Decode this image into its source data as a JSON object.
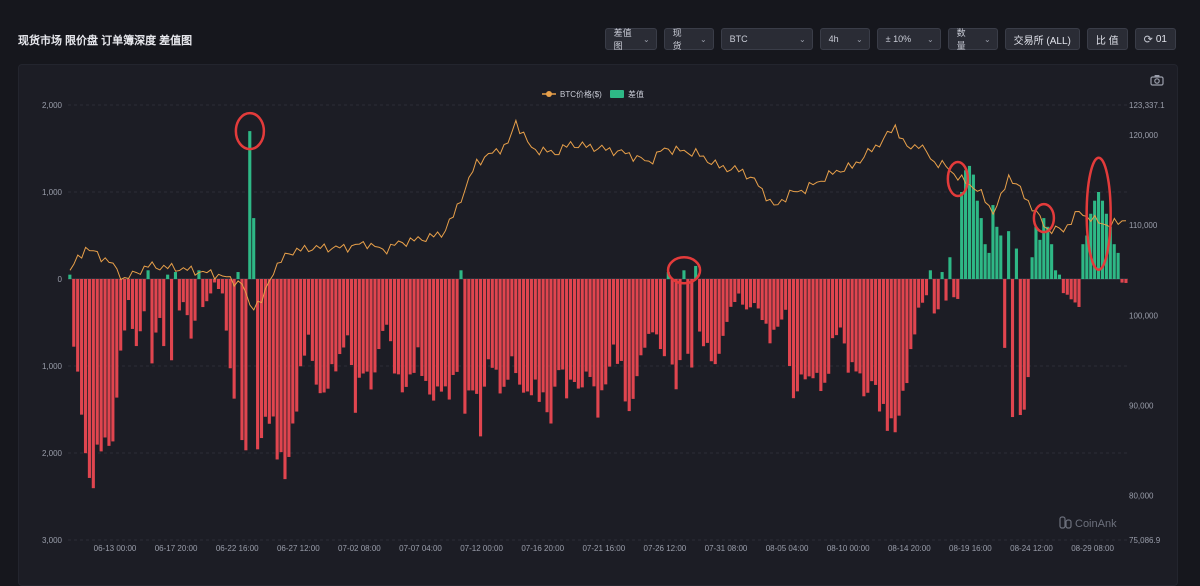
{
  "header": {
    "title": "现货市场 限价盘 订单簿深度 差值图"
  },
  "toolbar": {
    "chart_type": "差值图",
    "market": "现货",
    "coin": "BTC",
    "interval": "4h",
    "range": "± 10%",
    "metric": "数量",
    "exchange_button": "交易所 (ALL)",
    "ratio_button": "比 值",
    "refresh_label": "01"
  },
  "watermark": "CoinAnk",
  "colors": {
    "positive": "#2eb886",
    "negative": "#e0454f",
    "price_line": "#e8a04a",
    "highlight_circle": "#e33b3b",
    "background": "#1c1d25"
  },
  "chart_data": {
    "type": "bar",
    "legend": {
      "placement": "top-center",
      "entries": [
        "BTC价格($)",
        "差值"
      ]
    },
    "grid": true,
    "left_axis": {
      "ticks": [
        "2,000",
        "1,000",
        "0",
        "1,000",
        "2,000",
        "3,000"
      ],
      "range": [
        -3000,
        2000
      ]
    },
    "right_axis": {
      "ticks": [
        "123,337.1",
        "120,000",
        "110,000",
        "100,000",
        "90,000",
        "80,000",
        "75,086.9"
      ],
      "range": [
        75086.9,
        123337.1
      ]
    },
    "x_ticks": [
      "06-13 00:00",
      "06-17 20:00",
      "06-22 16:00",
      "06-27 12:00",
      "07-02 08:00",
      "07-07 04:00",
      "07-12 00:00",
      "07-16 20:00",
      "07-21 16:00",
      "07-26 12:00",
      "07-31 08:00",
      "08-05 04:00",
      "08-10 00:00",
      "08-14 20:00",
      "08-19 16:00",
      "08-24 12:00",
      "08-29 08:00"
    ],
    "series": [
      {
        "name": "差值",
        "anchors": [
          [
            0,
            -400
          ],
          [
            3,
            -1700
          ],
          [
            5,
            -2600
          ],
          [
            7,
            -2250
          ],
          [
            9,
            -2300
          ],
          [
            11,
            -2000
          ],
          [
            13,
            -1000
          ],
          [
            15,
            -300
          ],
          [
            17,
            -900
          ],
          [
            19,
            -400
          ],
          [
            21,
            -1000
          ],
          [
            23,
            -500
          ],
          [
            25,
            -1400
          ],
          [
            27,
            -600
          ],
          [
            29,
            -300
          ],
          [
            31,
            -700
          ],
          [
            33,
            -400
          ],
          [
            35,
            -300
          ],
          [
            37,
            -50
          ],
          [
            39,
            -200
          ],
          [
            41,
            -1100
          ],
          [
            43,
            -2000
          ],
          [
            45,
            -2300
          ],
          [
            47,
            -2200
          ],
          [
            49,
            -2000
          ],
          [
            51,
            -1800
          ],
          [
            53,
            -2200
          ],
          [
            55,
            -2500
          ],
          [
            57,
            -1900
          ],
          [
            59,
            -1200
          ],
          [
            61,
            -800
          ],
          [
            63,
            -1300
          ],
          [
            65,
            -1600
          ],
          [
            67,
            -1200
          ],
          [
            69,
            -1000
          ],
          [
            71,
            -700
          ],
          [
            73,
            -1600
          ],
          [
            75,
            -1200
          ],
          [
            77,
            -1400
          ],
          [
            79,
            -900
          ],
          [
            81,
            -600
          ],
          [
            83,
            -1100
          ],
          [
            85,
            -1400
          ],
          [
            87,
            -1300
          ],
          [
            89,
            -1000
          ],
          [
            91,
            -1400
          ],
          [
            93,
            -1500
          ],
          [
            95,
            -1300
          ],
          [
            97,
            -1600
          ],
          [
            99,
            -1200
          ],
          [
            101,
            -1700
          ],
          [
            103,
            -1400
          ],
          [
            105,
            -1900
          ],
          [
            107,
            -1000
          ],
          [
            109,
            -1200
          ],
          [
            111,
            -1500
          ],
          [
            113,
            -1100
          ],
          [
            115,
            -1300
          ],
          [
            117,
            -1600
          ],
          [
            119,
            -1400
          ],
          [
            121,
            -1500
          ],
          [
            123,
            -1800
          ],
          [
            125,
            -1100
          ],
          [
            127,
            -1500
          ],
          [
            129,
            -1300
          ],
          [
            131,
            -1400
          ],
          [
            133,
            -1300
          ],
          [
            135,
            -1600
          ],
          [
            137,
            -1300
          ],
          [
            139,
            -900
          ],
          [
            141,
            -1200
          ],
          [
            143,
            -1800
          ],
          [
            145,
            -1200
          ],
          [
            147,
            -800
          ],
          [
            149,
            -700
          ],
          [
            151,
            -900
          ],
          [
            153,
            -1000
          ],
          [
            155,
            -1400
          ],
          [
            157,
            -900
          ],
          [
            159,
            -1100
          ],
          [
            161,
            -700
          ],
          [
            163,
            -900
          ],
          [
            165,
            -1200
          ],
          [
            167,
            -700
          ],
          [
            169,
            -400
          ],
          [
            171,
            -200
          ],
          [
            173,
            -400
          ],
          [
            175,
            -300
          ],
          [
            177,
            -500
          ],
          [
            179,
            -800
          ],
          [
            181,
            -600
          ],
          [
            183,
            -400
          ],
          [
            185,
            -1600
          ],
          [
            187,
            -1400
          ],
          [
            189,
            -1200
          ],
          [
            191,
            -1300
          ],
          [
            193,
            -1500
          ],
          [
            195,
            -800
          ],
          [
            197,
            -600
          ],
          [
            199,
            -1100
          ],
          [
            201,
            -1200
          ],
          [
            203,
            -1500
          ],
          [
            205,
            -1300
          ],
          [
            207,
            -1700
          ],
          [
            209,
            -1800
          ],
          [
            211,
            -1900
          ],
          [
            213,
            -1500
          ],
          [
            215,
            -1000
          ],
          [
            217,
            -400
          ],
          [
            219,
            -200
          ],
          [
            221,
            -500
          ],
          [
            223,
            -300
          ],
          [
            225,
            -200
          ],
          [
            227,
            -250
          ],
          [
            229,
            -100
          ],
          [
            231,
            -200
          ],
          [
            233,
            -50
          ],
          [
            235,
            -100
          ],
          [
            237,
            -50
          ],
          [
            239,
            -1000
          ],
          [
            241,
            -1700
          ],
          [
            243,
            -1900
          ],
          [
            245,
            -1400
          ],
          [
            247,
            -1300
          ],
          [
            249,
            -1100
          ],
          [
            251,
            -300
          ],
          [
            253,
            -200
          ],
          [
            255,
            -200
          ],
          [
            257,
            -300
          ],
          [
            259,
            -500
          ],
          [
            261,
            -300
          ],
          [
            263,
            -200
          ],
          [
            265,
            -200
          ],
          [
            267,
            -100
          ],
          [
            269,
            -50
          ],
          [
            270,
            -50
          ]
        ],
        "spikes": [
          [
            0,
            50
          ],
          [
            20,
            100
          ],
          [
            25,
            50
          ],
          [
            27,
            80
          ],
          [
            33,
            100
          ],
          [
            43,
            80
          ],
          [
            46,
            1700
          ],
          [
            47,
            700
          ],
          [
            100,
            100
          ],
          [
            153,
            80
          ],
          [
            157,
            100
          ],
          [
            160,
            150
          ],
          [
            220,
            100
          ],
          [
            223,
            80
          ],
          [
            225,
            250
          ],
          [
            228,
            1000
          ],
          [
            229,
            1250
          ],
          [
            230,
            1300
          ],
          [
            231,
            1200
          ],
          [
            232,
            900
          ],
          [
            233,
            700
          ],
          [
            234,
            400
          ],
          [
            235,
            300
          ],
          [
            236,
            850
          ],
          [
            237,
            600
          ],
          [
            238,
            500
          ],
          [
            240,
            550
          ],
          [
            242,
            350
          ],
          [
            246,
            250
          ],
          [
            247,
            600
          ],
          [
            248,
            450
          ],
          [
            249,
            700
          ],
          [
            250,
            600
          ],
          [
            251,
            400
          ],
          [
            252,
            100
          ],
          [
            253,
            50
          ],
          [
            259,
            400
          ],
          [
            260,
            500
          ],
          [
            261,
            750
          ],
          [
            262,
            900
          ],
          [
            263,
            1000
          ],
          [
            264,
            900
          ],
          [
            265,
            750
          ],
          [
            266,
            600
          ],
          [
            267,
            400
          ],
          [
            268,
            300
          ]
        ]
      },
      {
        "name": "BTC价格($)",
        "values": [
          [
            0,
            105000
          ],
          [
            4,
            107500
          ],
          [
            10,
            106000
          ],
          [
            14,
            104000
          ],
          [
            20,
            105500
          ],
          [
            28,
            105200
          ],
          [
            38,
            104500
          ],
          [
            44,
            103500
          ],
          [
            46,
            101000
          ],
          [
            49,
            101500
          ],
          [
            52,
            105000
          ],
          [
            56,
            107000
          ],
          [
            62,
            107500
          ],
          [
            70,
            107500
          ],
          [
            76,
            108000
          ],
          [
            80,
            107200
          ],
          [
            84,
            108000
          ],
          [
            90,
            108500
          ],
          [
            95,
            109000
          ],
          [
            98,
            111000
          ],
          [
            101,
            114000
          ],
          [
            104,
            117000
          ],
          [
            108,
            118000
          ],
          [
            112,
            119000
          ],
          [
            114,
            121500
          ],
          [
            118,
            118500
          ],
          [
            124,
            118000
          ],
          [
            128,
            119000
          ],
          [
            136,
            118500
          ],
          [
            142,
            118000
          ],
          [
            148,
            117000
          ],
          [
            152,
            118500
          ],
          [
            160,
            118000
          ],
          [
            166,
            116500
          ],
          [
            172,
            116000
          ],
          [
            176,
            114500
          ],
          [
            180,
            112000
          ],
          [
            184,
            113500
          ],
          [
            188,
            114000
          ],
          [
            192,
            115000
          ],
          [
            196,
            116000
          ],
          [
            200,
            116500
          ],
          [
            204,
            118000
          ],
          [
            208,
            119500
          ],
          [
            211,
            121000
          ],
          [
            214,
            118500
          ],
          [
            217,
            119000
          ],
          [
            221,
            117000
          ],
          [
            224,
            116500
          ],
          [
            228,
            115000
          ],
          [
            232,
            114000
          ],
          [
            236,
            111500
          ],
          [
            238,
            113000
          ],
          [
            240,
            115500
          ],
          [
            242,
            114500
          ],
          [
            246,
            112000
          ],
          [
            250,
            109500
          ],
          [
            254,
            109500
          ],
          [
            258,
            111500
          ],
          [
            262,
            110500
          ],
          [
            266,
            110000
          ],
          [
            269,
            110500
          ],
          [
            270,
            110500
          ]
        ]
      }
    ]
  }
}
